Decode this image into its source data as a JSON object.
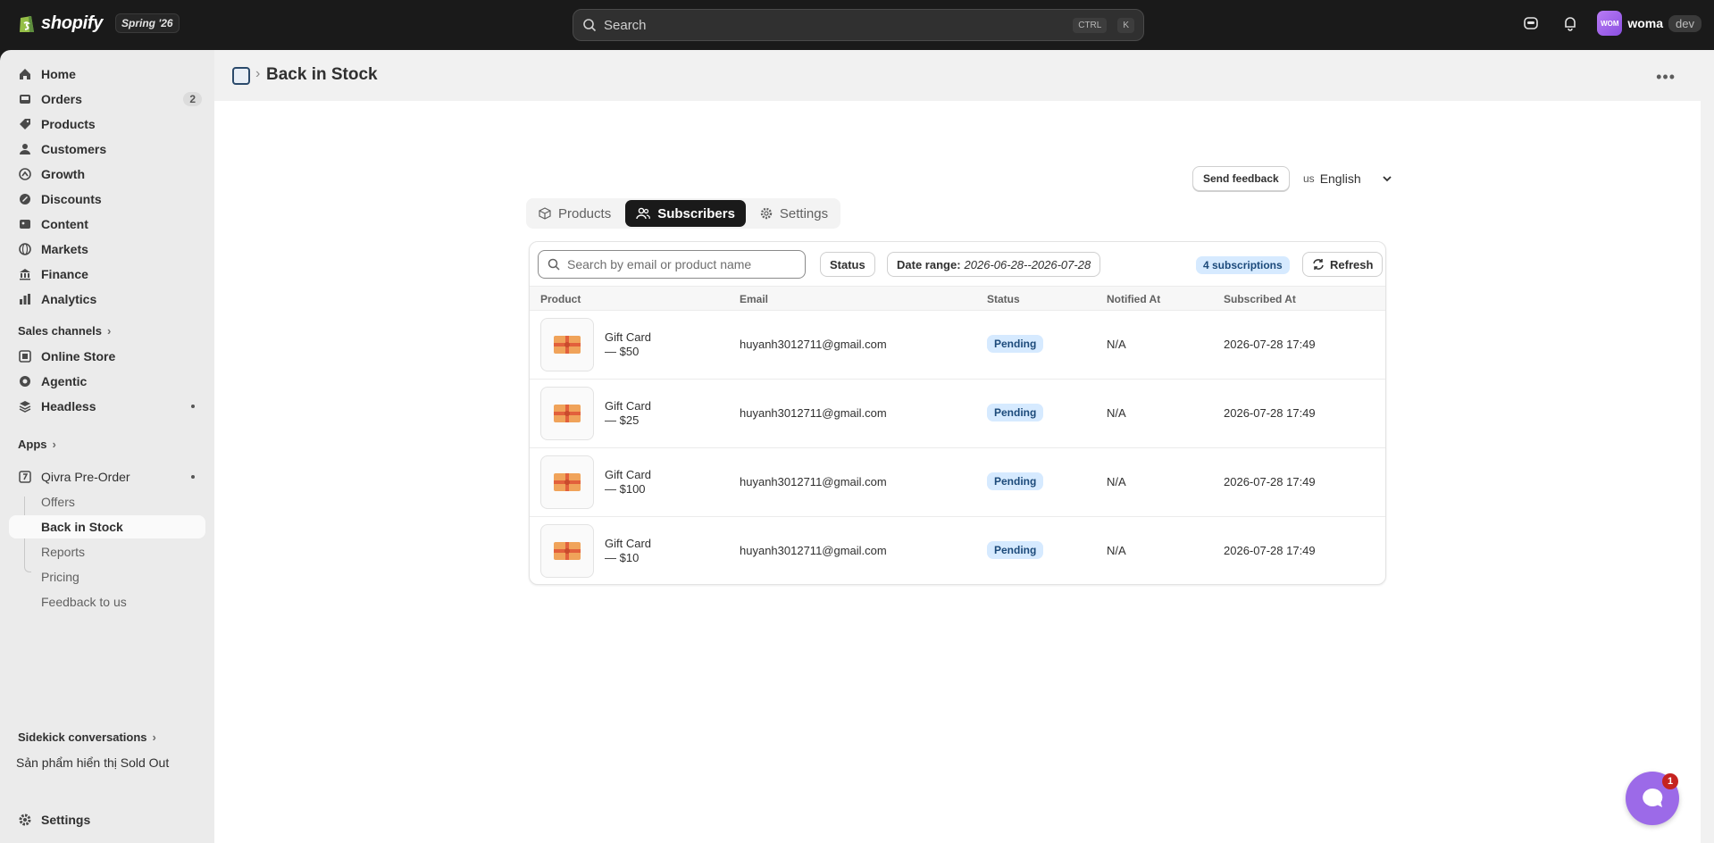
{
  "topbar": {
    "brand": "shopify",
    "edition": "Spring '26",
    "search_placeholder": "Search",
    "shortcut_mod": "CTRL",
    "shortcut_key": "K",
    "avatar_initials": "WOM",
    "user_name": "woma",
    "env_badge": "dev"
  },
  "sidebar": {
    "items": [
      {
        "label": "Home",
        "icon": "home-icon"
      },
      {
        "label": "Orders",
        "icon": "inbox-icon",
        "count": "2"
      },
      {
        "label": "Products",
        "icon": "tag-icon"
      },
      {
        "label": "Customers",
        "icon": "person-icon"
      },
      {
        "label": "Growth",
        "icon": "growth-icon"
      },
      {
        "label": "Discounts",
        "icon": "discount-icon"
      },
      {
        "label": "Content",
        "icon": "content-icon"
      },
      {
        "label": "Markets",
        "icon": "globe-icon"
      },
      {
        "label": "Finance",
        "icon": "bank-icon"
      },
      {
        "label": "Analytics",
        "icon": "chart-icon"
      }
    ],
    "sales_channels_label": "Sales channels",
    "channels": [
      {
        "label": "Online Store",
        "icon": "store-icon"
      },
      {
        "label": "Agentic",
        "icon": "agentic-icon"
      },
      {
        "label": "Headless",
        "icon": "headless-icon"
      }
    ],
    "apps_label": "Apps",
    "app_name": "Qivra Pre-Order",
    "app_subitems": [
      "Offers",
      "Back in Stock",
      "Reports",
      "Pricing",
      "Feedback to us"
    ],
    "sidekick_label": "Sidekick conversations",
    "sidekick_item": "Sản phẩm hiển thị Sold Out",
    "settings_label": "Settings"
  },
  "page": {
    "title": "Back in Stock",
    "feedback_label": "Send feedback",
    "lang_code": "us",
    "lang_label": "English"
  },
  "tabs": [
    {
      "label": "Products",
      "icon": "cube-icon"
    },
    {
      "label": "Subscribers",
      "icon": "people-icon"
    },
    {
      "label": "Settings",
      "icon": "gear-icon"
    }
  ],
  "filters": {
    "search_placeholder": "Search by email or product name",
    "status_label": "Status",
    "date_label": "Date range:",
    "date_value": "2026-06-28--2026-07-28",
    "subs_count": "4 subscriptions",
    "refresh_label": "Refresh"
  },
  "table": {
    "columns": [
      "Product",
      "Email",
      "Status",
      "Notified At",
      "Subscribed At"
    ],
    "rows": [
      {
        "product": "Gift Card",
        "variant": "— $50",
        "email": "huyanh3012711@gmail.com",
        "status": "Pending",
        "notified": "N/A",
        "subscribed": "2026-07-28 17:49"
      },
      {
        "product": "Gift Card",
        "variant": "— $25",
        "email": "huyanh3012711@gmail.com",
        "status": "Pending",
        "notified": "N/A",
        "subscribed": "2026-07-28 17:49"
      },
      {
        "product": "Gift Card",
        "variant": "— $100",
        "email": "huyanh3012711@gmail.com",
        "status": "Pending",
        "notified": "N/A",
        "subscribed": "2026-07-28 17:49"
      },
      {
        "product": "Gift Card",
        "variant": "— $10",
        "email": "huyanh3012711@gmail.com",
        "status": "Pending",
        "notified": "N/A",
        "subscribed": "2026-07-28 17:49"
      }
    ]
  },
  "chat": {
    "unread": "1"
  },
  "colors": {
    "accent": "#1a1a1a",
    "pending_bg": "#d6eaff",
    "chat": "#9c6ae8"
  }
}
